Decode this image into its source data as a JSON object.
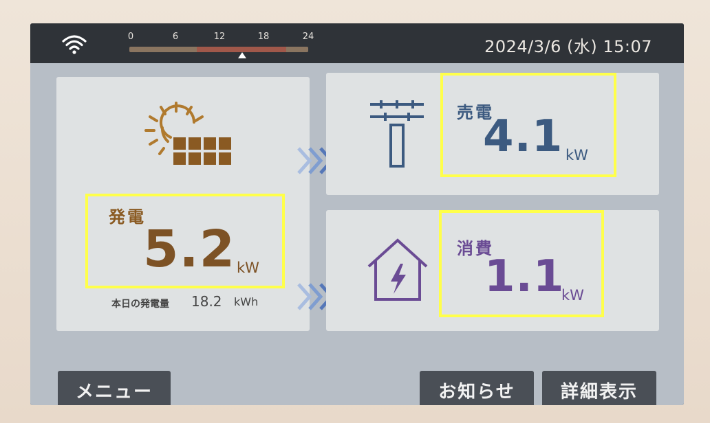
{
  "status_bar": {
    "datetime": "2024/3/6 (水) 15:07",
    "time_scale": {
      "ticks": [
        "0",
        "6",
        "12",
        "18",
        "24"
      ],
      "current_hour_fraction": 0.63
    }
  },
  "generation": {
    "label": "発電",
    "value": "5.2",
    "unit": "kW",
    "today_label": "本日の発電量",
    "today_value": "18.2",
    "today_unit": "kWh"
  },
  "sell": {
    "label": "売電",
    "value": "4.1",
    "unit": "kW"
  },
  "consumption": {
    "label": "消費",
    "value": "1.1",
    "unit": "kW"
  },
  "buttons": {
    "menu": "メニュー",
    "news": "お知らせ",
    "detail": "詳細表示"
  },
  "colors": {
    "generation": "#7d5225",
    "sell": "#3c5a80",
    "consumption": "#6a4b94",
    "highlight": "#ffff4a"
  },
  "icons": [
    "wifi-icon",
    "sun-solar-panel-icon",
    "utility-pole-icon",
    "house-lightning-icon",
    "triple-chevron-right-icon"
  ]
}
